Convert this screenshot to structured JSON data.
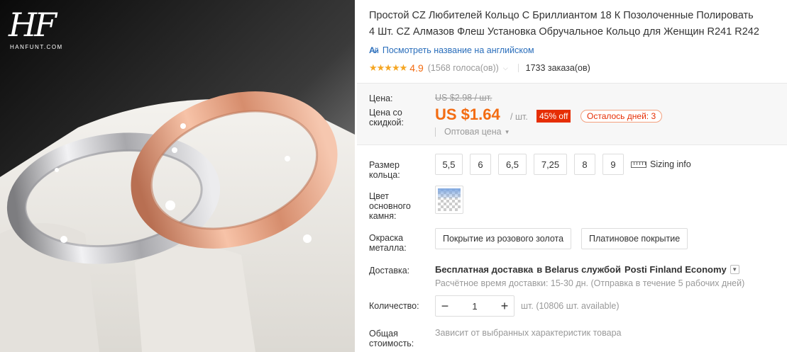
{
  "brand": {
    "logo_mark": "HF",
    "logo_text": "HANFUNT.COM"
  },
  "product": {
    "title_line1": "Простой CZ Любителей Кольцо С Бриллиантом 18 К Позолоченные Полировать",
    "title_line2": "4 Шт. CZ Алмазов Флеш Установка Обручальное Кольцо для Женщин R241 R242",
    "translate_link": "Посмотреть название на английском",
    "translate_icon": "translate-icon"
  },
  "rating": {
    "stars": "★★★★★",
    "value": "4.9",
    "votes": "(1568 голоса(ов))",
    "orders": "1733 заказа(ов)"
  },
  "price": {
    "price_label": "Цена:",
    "old_price": "US $2.98 / шт.",
    "discount_price_label": "Цена со скидкой:",
    "current_price": "US $1.64",
    "per_unit": "/ шт.",
    "discount_badge": "45% off",
    "days_left": "Осталось дней: 3",
    "wholesale": "Оптовая цена"
  },
  "options": {
    "size_label": "Размер кольца:",
    "sizes": [
      "5,5",
      "6",
      "6,5",
      "7,25",
      "8",
      "9"
    ],
    "sizing_info": "Sizing info",
    "stone_color_label": "Цвет основного камня:",
    "plating_label": "Окраска металла:",
    "plating": [
      "Покрытие из розового золота",
      "Платиновое покрытие"
    ]
  },
  "shipping": {
    "label": "Доставка:",
    "prefix": "Бесплатная доставка",
    "middle": "в Belarus службой",
    "carrier": "Posti Finland Economy",
    "estimate": "Расчётное время доставки: 15-30 дн. (Отправка в течение 5 рабочих дней)"
  },
  "quantity": {
    "label": "Количество:",
    "minus": "−",
    "value": "1",
    "plus": "+",
    "available": "шт. (10806 шт. available)"
  },
  "total": {
    "label": "Общая стоимость:",
    "value": "Зависит от выбранных характеристик товара"
  },
  "colors": {
    "accent_orange": "#f36c12",
    "discount_red": "#e62e04",
    "link_blue": "#2a6ebb",
    "star_gold": "#f5a623"
  }
}
